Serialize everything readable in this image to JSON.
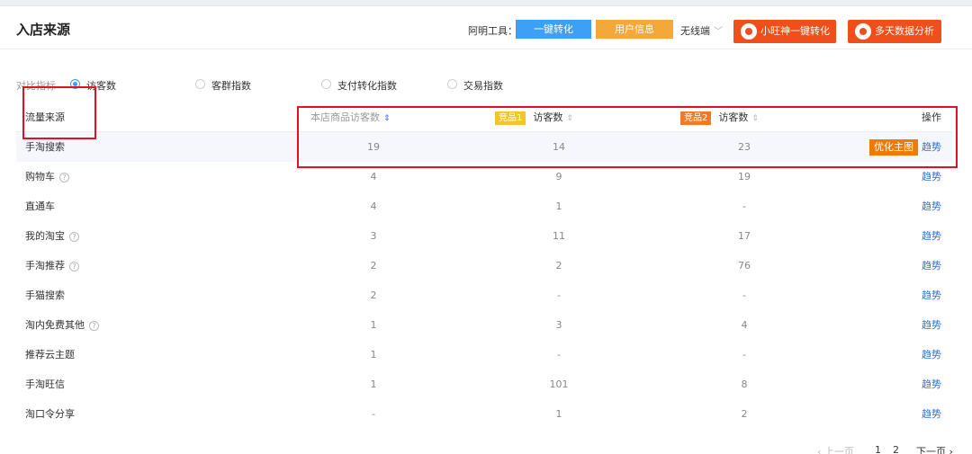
{
  "header": {
    "title": "入店来源",
    "tools_label": "阿明工具：",
    "convert_button": "一键转化",
    "userinfo_button": "用户信息",
    "device_select": "无线端",
    "xiaowang_button": "小旺神一键转化",
    "multiday_button": "多天数据分析"
  },
  "metrics": {
    "label": "对比指标",
    "options": [
      {
        "label": "访客数",
        "checked": true
      },
      {
        "label": "客群指数",
        "checked": false
      },
      {
        "label": "支付转化指数",
        "checked": false
      },
      {
        "label": "交易指数",
        "checked": false
      }
    ]
  },
  "table": {
    "headers": {
      "source": "流量来源",
      "own": "本店商品访客数",
      "comp1_badge": "竞品1",
      "comp1": "访客数",
      "comp2_badge": "竞品2",
      "comp2": "访客数",
      "action": "操作"
    },
    "rows": [
      {
        "source": "手淘搜索",
        "own": "19",
        "comp1": "14",
        "comp2": "23",
        "optimize": "优化主图",
        "trend": "趋势"
      },
      {
        "source": "购物车",
        "help": "?",
        "own": "4",
        "comp1": "9",
        "comp2": "19",
        "trend": "趋势"
      },
      {
        "source": "直通车",
        "own": "4",
        "comp1": "1",
        "comp2": "-",
        "trend": "趋势"
      },
      {
        "source": "我的淘宝",
        "help": "?",
        "own": "3",
        "comp1": "11",
        "comp2": "17",
        "trend": "趋势"
      },
      {
        "source": "手淘推荐",
        "help": "?",
        "own": "2",
        "comp1": "2",
        "comp2": "76",
        "trend": "趋势"
      },
      {
        "source": "手猫搜索",
        "own": "2",
        "comp1": "-",
        "comp2": "-",
        "trend": "趋势"
      },
      {
        "source": "淘内免费其他",
        "help": "?",
        "own": "1",
        "comp1": "3",
        "comp2": "4",
        "trend": "趋势"
      },
      {
        "source": "推荐云主题",
        "own": "1",
        "comp1": "-",
        "comp2": "-",
        "trend": "趋势"
      },
      {
        "source": "手淘旺信",
        "own": "1",
        "comp1": "101",
        "comp2": "8",
        "trend": "趋势"
      },
      {
        "source": "淘口令分享",
        "own": "-",
        "comp1": "1",
        "comp2": "2",
        "trend": "趋势"
      }
    ]
  },
  "pagination": {
    "prev": "‹ 上一页",
    "pages": [
      "1",
      "2"
    ],
    "next": "下一页 ›"
  },
  "colors": {
    "accent_blue": "#3d9ff5",
    "accent_orange": "#f04e1a",
    "annotation_red": "#e0141e"
  }
}
